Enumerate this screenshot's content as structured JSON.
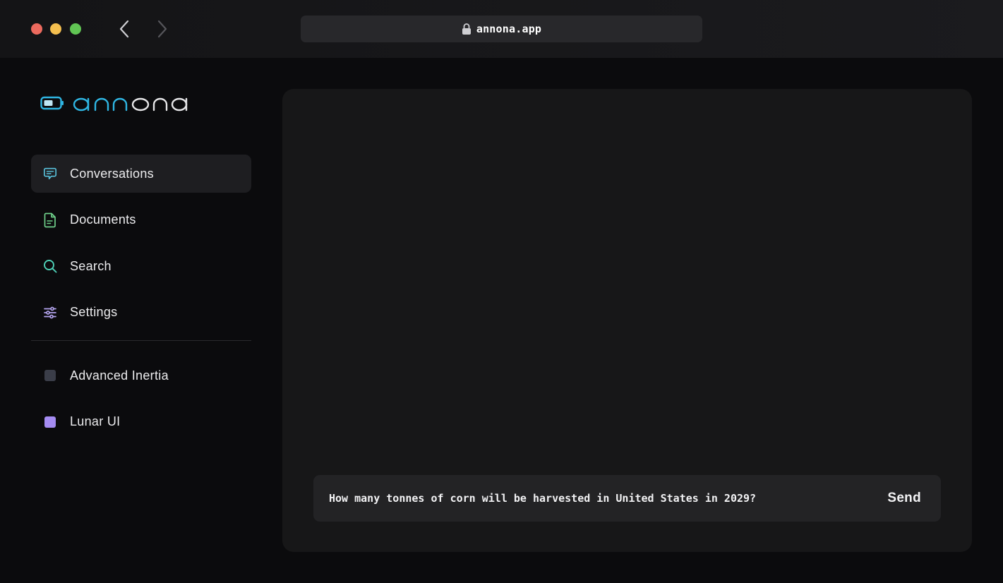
{
  "browser": {
    "url": "annona.app",
    "icons": {
      "lock": "lock-icon",
      "back": "chevron-left-icon",
      "forward": "chevron-right-icon"
    }
  },
  "brand": {
    "name": "annona",
    "accent": "#2fb6e3",
    "text": "#e6e6e8"
  },
  "sidebar": {
    "items": [
      {
        "label": "Conversations",
        "icon": "chat-bubble-icon",
        "active": true,
        "color": "#59c2dc"
      },
      {
        "label": "Documents",
        "icon": "document-icon",
        "active": false,
        "color": "#6fd08a"
      },
      {
        "label": "Search",
        "icon": "search-icon",
        "active": false,
        "color": "#4fd2b8"
      },
      {
        "label": "Settings",
        "icon": "sliders-icon",
        "active": false,
        "color": "#b3a4ee"
      }
    ],
    "projects": [
      {
        "label": "Advanced Inertia",
        "color": "#3a3d48"
      },
      {
        "label": "Lunar UI",
        "color": "#a58cf2"
      }
    ]
  },
  "composer": {
    "value": "How many tonnes of corn will be harvested in United States in 2029?",
    "send_label": "Send"
  }
}
